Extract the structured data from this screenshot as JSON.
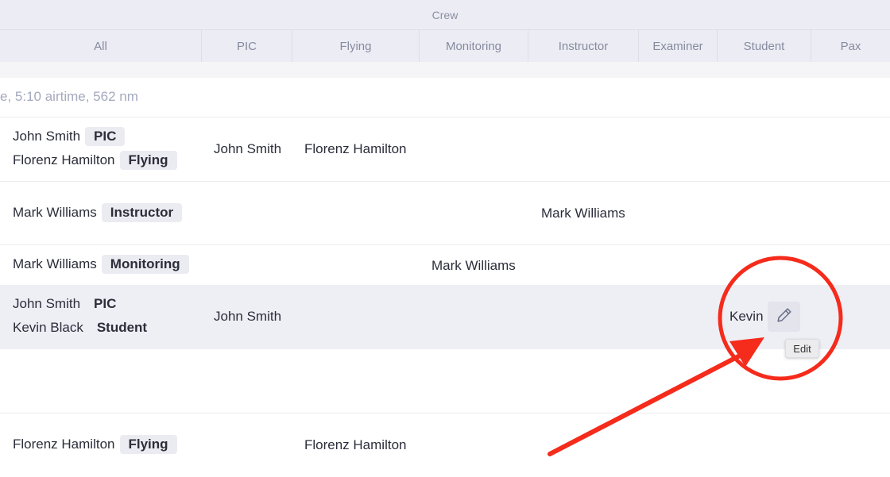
{
  "header": {
    "group_title": "Crew",
    "columns": [
      "All",
      "PIC",
      "Flying",
      "Monitoring",
      "Instructor",
      "Examiner",
      "Student",
      "Pax"
    ]
  },
  "summary": "e, 5:10 airtime, 562 nm",
  "rows": [
    {
      "all": [
        {
          "name": "John Smith",
          "role": "PIC"
        },
        {
          "name": "Florenz Hamilton",
          "role": "Flying"
        }
      ],
      "pic": "John Smith",
      "flying": "Florenz Hamilton"
    },
    {
      "all": [
        {
          "name": "Mark Williams",
          "role": "Instructor"
        }
      ],
      "instructor": "Mark Williams"
    },
    {
      "all": [
        {
          "name": "Mark Williams",
          "role": "Monitoring"
        }
      ],
      "monitoring": "Mark Williams"
    },
    {
      "all": [
        {
          "name": "John Smith",
          "role": "PIC"
        },
        {
          "name": "Kevin Black",
          "role": "Student"
        }
      ],
      "pic": "John Smith",
      "student": "Kevin",
      "edit_tooltip": "Edit"
    },
    {
      "all": [
        {
          "name": "Florenz Hamilton",
          "role": "Flying"
        }
      ],
      "flying": "Florenz Hamilton"
    }
  ],
  "icons": {
    "edit": "pencil-icon"
  },
  "colors": {
    "annotation": "#f52b1c",
    "header_bg": "#ecedf4",
    "highlight_row_bg": "#eeeff5",
    "tag_bg": "#ebecf1"
  }
}
